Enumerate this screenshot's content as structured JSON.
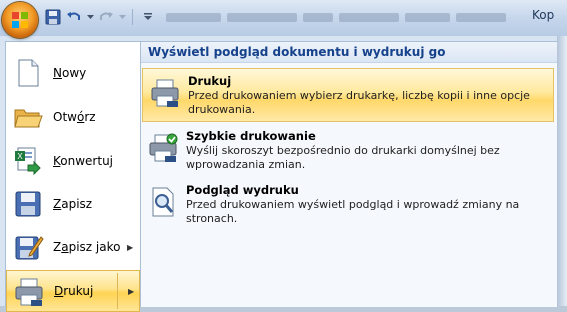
{
  "titlebar": {
    "title": "Kop"
  },
  "qat": {
    "icons": [
      "office-logo",
      "save-icon",
      "undo-icon",
      "redo-icon",
      "customize-icon"
    ]
  },
  "menu": {
    "left_items": [
      {
        "label": "Nowy",
        "key": "N",
        "icon": "new-document-icon"
      },
      {
        "label": "Otwórz",
        "key": "O",
        "icon": "open-folder-icon"
      },
      {
        "label": "Konwertuj",
        "key": "K",
        "icon": "convert-icon"
      },
      {
        "label": "Zapisz",
        "key": "Z",
        "icon": "save-icon"
      },
      {
        "label": "Zapisz jako",
        "key": "a",
        "icon": "save-as-icon",
        "has_submenu": true
      },
      {
        "label": "Drukuj",
        "key": "D",
        "icon": "printer-icon",
        "has_submenu": true,
        "active": true
      }
    ],
    "submenu": {
      "header": "Wyświetl podgląd dokumentu i wydrukuj go",
      "items": [
        {
          "title": "Drukuj",
          "description": "Przed drukowaniem wybierz drukarkę, liczbę kopii i inne opcje drukowania.",
          "icon": "printer-icon",
          "highlighted": true
        },
        {
          "title": "Szybkie drukowanie",
          "description": "Wyślij skoroszyt bezpośrednio do drukarki domyślnej bez wprowadzania zmian.",
          "icon": "quick-print-icon"
        },
        {
          "title": "Podgląd wydruku",
          "description": "Przed drukowaniem wyświetl podgląd i wprowadź zmiany na stronach.",
          "icon": "print-preview-icon"
        }
      ]
    }
  },
  "colors": {
    "hover_gold": "#ffd86a",
    "header_blue": "#15428b",
    "frame_blue": "#d9e4f2"
  }
}
